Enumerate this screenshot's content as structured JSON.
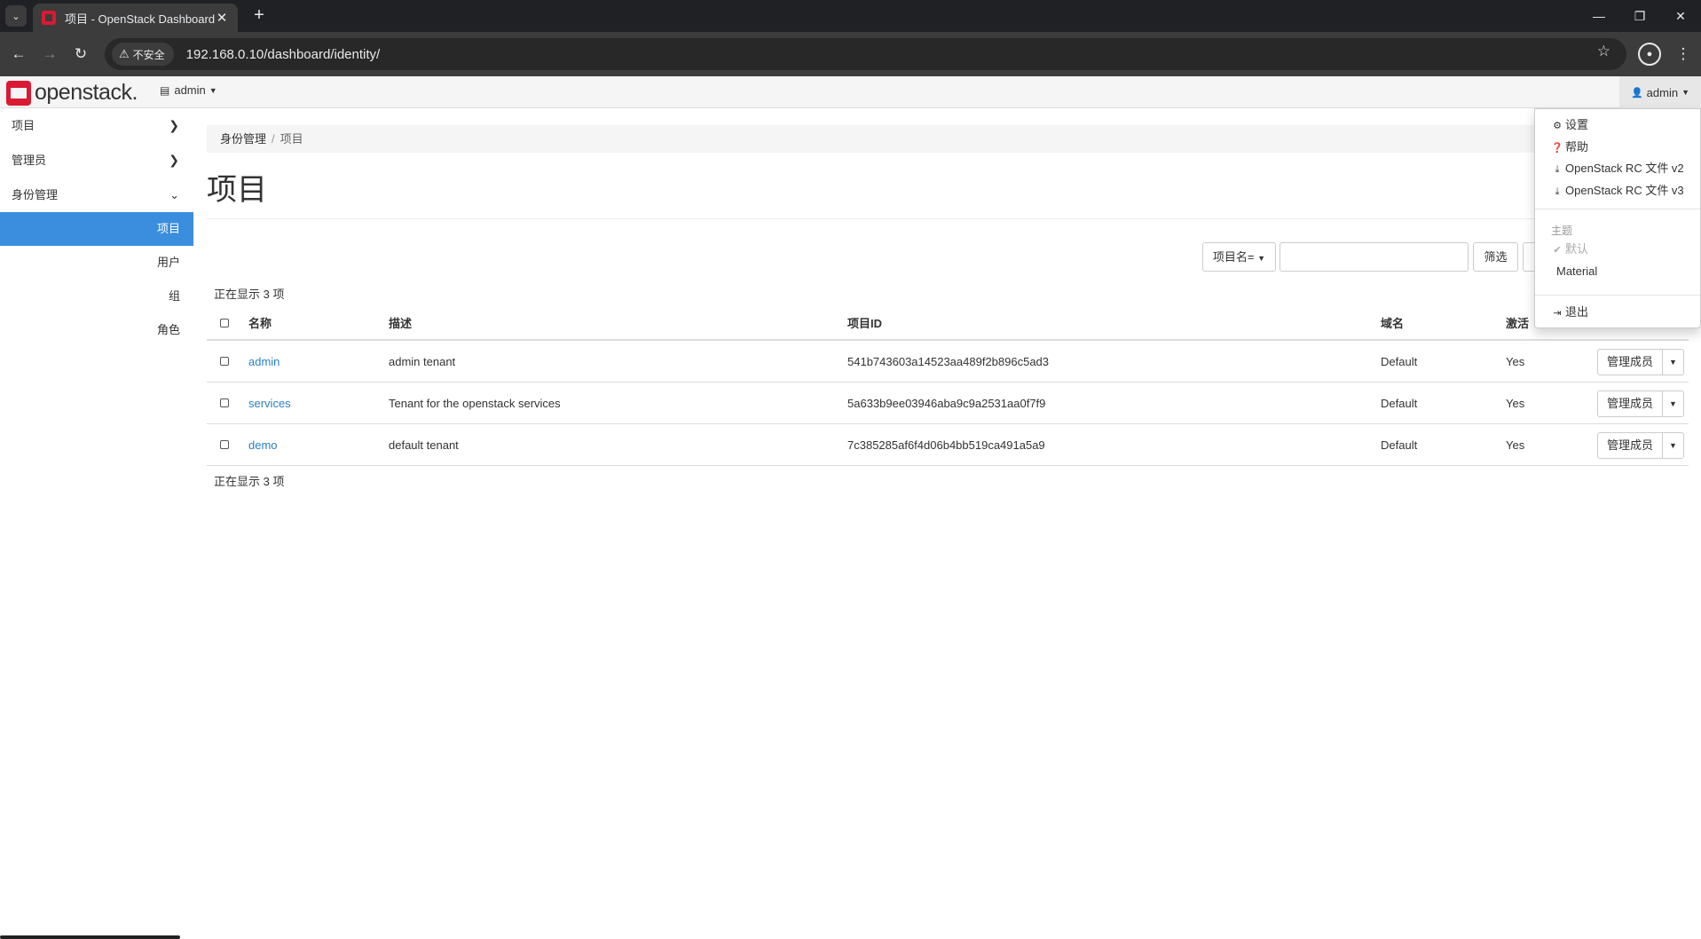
{
  "browser": {
    "tab_title": "项目 - OpenStack Dashboard",
    "tab_close": "✕",
    "new_tab": "+",
    "security_label": "不安全",
    "url": "192.168.0.10/dashboard/identity/"
  },
  "header": {
    "logo_text": "openstack.",
    "project_switcher": "admin",
    "user_menu": "admin"
  },
  "sidebar": {
    "groups": [
      {
        "label": "项目",
        "expanded": false
      },
      {
        "label": "管理员",
        "expanded": false
      },
      {
        "label": "身份管理",
        "expanded": true
      }
    ],
    "items": [
      {
        "label": "项目",
        "active": true
      },
      {
        "label": "用户",
        "active": false
      },
      {
        "label": "组",
        "active": false
      },
      {
        "label": "角色",
        "active": false
      }
    ]
  },
  "breadcrumb": {
    "parent": "身份管理",
    "separator": "/",
    "current": "项目"
  },
  "page": {
    "title": "项目"
  },
  "filter": {
    "field_select": "项目名=",
    "input_value": "",
    "filter_button": "筛选"
  },
  "table": {
    "count_label": "正在显示 3 项",
    "headers": {
      "name": "名称",
      "description": "描述",
      "project_id": "项目ID",
      "domain": "域名",
      "enabled": "激活"
    },
    "rows": [
      {
        "name": "admin",
        "description": "admin tenant",
        "project_id": "541b743603a14523aa489f2b896c5ad3",
        "domain": "Default",
        "enabled": "Yes",
        "action": "管理成员"
      },
      {
        "name": "services",
        "description": "Tenant for the openstack services",
        "project_id": "5a633b9ee03946aba9c9a2531aa0f7f9",
        "domain": "Default",
        "enabled": "Yes",
        "action": "管理成员"
      },
      {
        "name": "demo",
        "description": "default tenant",
        "project_id": "7c385285af6f4d06b4bb519ca491a5a9",
        "domain": "Default",
        "enabled": "Yes",
        "action": "管理成员"
      }
    ]
  },
  "user_dropdown": {
    "settings": "设置",
    "help": "帮助",
    "rc_v2": "OpenStack RC 文件 v2",
    "rc_v3": "OpenStack RC 文件 v3",
    "theme_header": "主题",
    "theme_default": "默认",
    "theme_material": "Material",
    "logout": "退出"
  },
  "colors": {
    "accent": "#3b8ede",
    "link": "#2a7fca",
    "brand": "#da1a32"
  }
}
